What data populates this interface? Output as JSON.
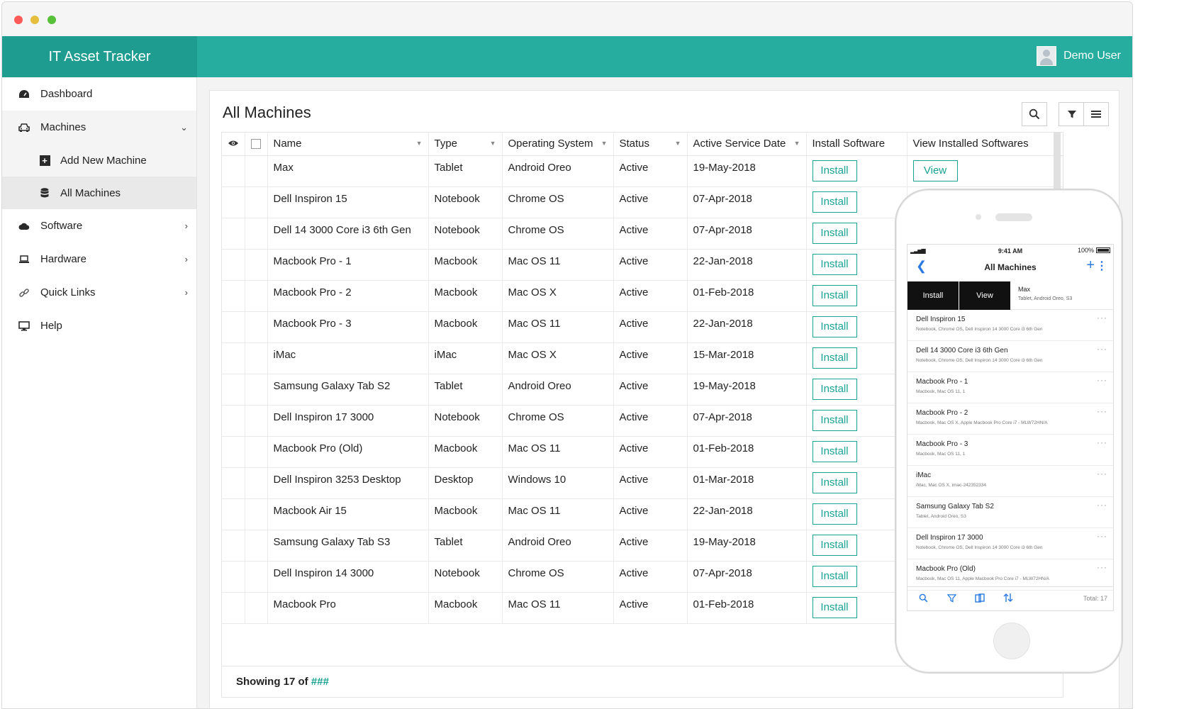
{
  "app": {
    "title": "IT Asset Tracker",
    "user_name": "Demo User"
  },
  "sidebar": {
    "items": [
      {
        "label": "Dashboard"
      },
      {
        "label": "Machines"
      },
      {
        "label": "Add New Machine"
      },
      {
        "label": "All Machines"
      },
      {
        "label": "Software"
      },
      {
        "label": "Hardware"
      },
      {
        "label": "Quick Links"
      },
      {
        "label": "Help"
      }
    ]
  },
  "main": {
    "title": "All Machines",
    "columns": [
      "Name",
      "Type",
      "Operating System",
      "Status",
      "Active Service Date",
      "Install Software",
      "View Installed Softwares"
    ],
    "install_label": "Install",
    "view_label": "View",
    "rows": [
      {
        "name": "Max",
        "type": "Tablet",
        "os": "Android Oreo",
        "status": "Active",
        "date": "19-May-2018"
      },
      {
        "name": "Dell Inspiron 15",
        "type": "Notebook",
        "os": "Chrome OS",
        "status": "Active",
        "date": "07-Apr-2018"
      },
      {
        "name": "Dell 14 3000 Core i3 6th Gen",
        "type": "Notebook",
        "os": "Chrome OS",
        "status": "Active",
        "date": "07-Apr-2018"
      },
      {
        "name": "Macbook Pro - 1",
        "type": "Macbook",
        "os": "Mac OS 11",
        "status": "Active",
        "date": "22-Jan-2018"
      },
      {
        "name": "Macbook Pro - 2",
        "type": "Macbook",
        "os": "Mac OS X",
        "status": "Active",
        "date": "01-Feb-2018"
      },
      {
        "name": "Macbook Pro - 3",
        "type": "Macbook",
        "os": "Mac OS 11",
        "status": "Active",
        "date": "22-Jan-2018"
      },
      {
        "name": "iMac",
        "type": "iMac",
        "os": "Mac OS X",
        "status": "Active",
        "date": "15-Mar-2018"
      },
      {
        "name": "Samsung Galaxy Tab S2",
        "type": "Tablet",
        "os": "Android Oreo",
        "status": "Active",
        "date": "19-May-2018"
      },
      {
        "name": "Dell Inspiron 17 3000",
        "type": "Notebook",
        "os": "Chrome OS",
        "status": "Active",
        "date": "07-Apr-2018"
      },
      {
        "name": "Macbook Pro (Old)",
        "type": "Macbook",
        "os": "Mac OS 11",
        "status": "Active",
        "date": "01-Feb-2018"
      },
      {
        "name": "Dell Inspiron 3253 Desktop",
        "type": "Desktop",
        "os": "Windows 10",
        "status": "Active",
        "date": "01-Mar-2018"
      },
      {
        "name": "Macbook Air 15",
        "type": "Macbook",
        "os": "Mac OS 11",
        "status": "Active",
        "date": "22-Jan-2018"
      },
      {
        "name": "Samsung Galaxy Tab S3",
        "type": "Tablet",
        "os": "Android Oreo",
        "status": "Active",
        "date": "19-May-2018"
      },
      {
        "name": "Dell Inspiron 14 3000",
        "type": "Notebook",
        "os": "Chrome OS",
        "status": "Active",
        "date": "07-Apr-2018"
      },
      {
        "name": "Macbook Pro",
        "type": "Macbook",
        "os": "Mac OS 11",
        "status": "Active",
        "date": "01-Feb-2018"
      }
    ],
    "footer_text": "Showing 17 of",
    "footer_hashes": "###"
  },
  "mobile": {
    "time": "9:41 AM",
    "battery": "100%",
    "title": "All Machines",
    "swipe_install": "Install",
    "swipe_view": "View",
    "swipe_row": {
      "name": "Max",
      "sub": "Tablet, Android Oreo, S3"
    },
    "rows": [
      {
        "name": "Dell Inspiron 15",
        "sub": "Notebook, Chrome OS, Dell Inspiron 14 3000 Core i3 6th Gen"
      },
      {
        "name": "Dell 14 3000 Core i3 6th Gen",
        "sub": "Notebook, Chrome OS, Dell Inspiron 14 3000 Core i3 6th Gen"
      },
      {
        "name": "Macbook Pro - 1",
        "sub": "Macbook, Mac OS 11, 1"
      },
      {
        "name": "Macbook Pro - 2",
        "sub": "Macbook, Mac OS X, Apple Macbook Pro Core i7 - MLW72HN/A"
      },
      {
        "name": "Macbook Pro - 3",
        "sub": "Macbook, Mac OS 11, 1"
      },
      {
        "name": "iMac",
        "sub": "iMac, Mac OS X, imac-242352334"
      },
      {
        "name": "Samsung Galaxy Tab S2",
        "sub": "Tablet, Android Oreo, S3"
      },
      {
        "name": "Dell Inspiron 17 3000",
        "sub": "Notebook, Chrome OS, Dell Inspiron 14 3000 Core i3 6th Gen"
      },
      {
        "name": "Macbook Pro (Old)",
        "sub": "Macbook, Mac OS 11, Apple Macbook Pro Core i7 - MLW72HN/A"
      }
    ],
    "total": "Total: 17"
  }
}
